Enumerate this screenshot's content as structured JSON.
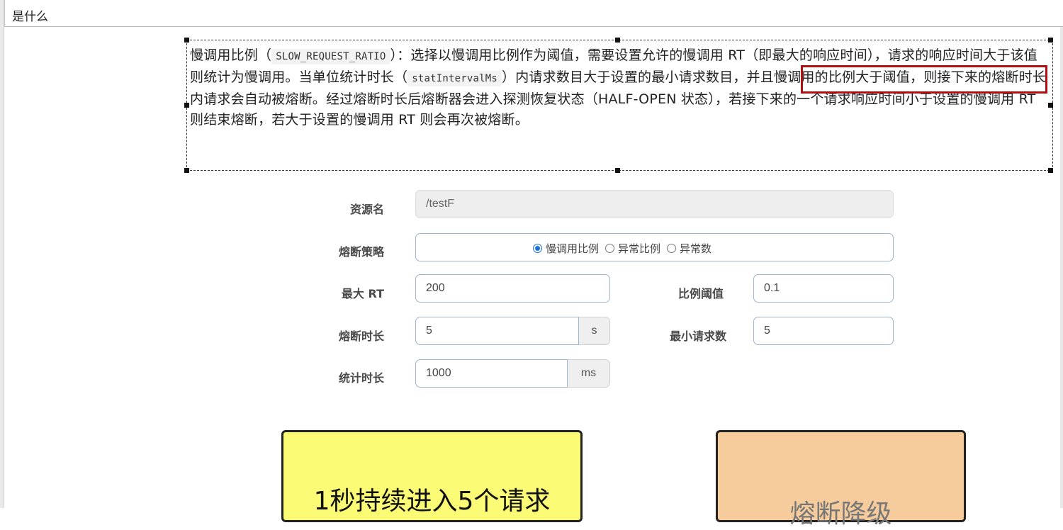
{
  "header": {
    "title": "是什么"
  },
  "description": {
    "part1": "慢调用比例（",
    "code1": "SLOW_REQUEST_RATIO",
    "part2": "）：选择以慢调用比例作为阈值，需要设置允许的慢调用 RT（即最大的响应时间），请求的响应时间大于该值则统计为慢调用。当单位统计时长（",
    "code2": "statIntervalMs",
    "part3": "）内请求数目大于设置的最小请求数目，并且慢调用的比例大于阈值，则接下来的熔断时长内请求会自动被熔断。经过熔断时长后熔断器会进入探测恢复状态（HALF-OPEN 状态），若接下来的一个请求响应时间小于设置的慢调用 RT 则结束熔断，若大于设置的慢调用 RT 则会再次被熔断。"
  },
  "form": {
    "resource_label": "资源名",
    "resource_value": "/testF",
    "strategy_label": "熔断策略",
    "strategy_options": [
      "慢调用比例",
      "异常比例",
      "异常数"
    ],
    "strategy_selected": "慢调用比例",
    "max_rt_label": "最大 RT",
    "max_rt_value": "200",
    "ratio_label": "比例阈值",
    "ratio_value": "0.1",
    "break_time_label": "熔断时长",
    "break_time_value": "5",
    "break_time_unit": "s",
    "min_req_label": "最小请求数",
    "min_req_value": "5",
    "stat_label": "统计时长",
    "stat_value": "1000",
    "stat_unit": "ms"
  },
  "cards": {
    "left_text": "1秒持续进入5个请求",
    "right_text": "熔断降级"
  },
  "colors": {
    "highlight_border": "#b01010",
    "left_card_bg": "#fbfb76",
    "right_card_bg": "#f6cc9d",
    "radio_accent": "#1a6fd8"
  }
}
